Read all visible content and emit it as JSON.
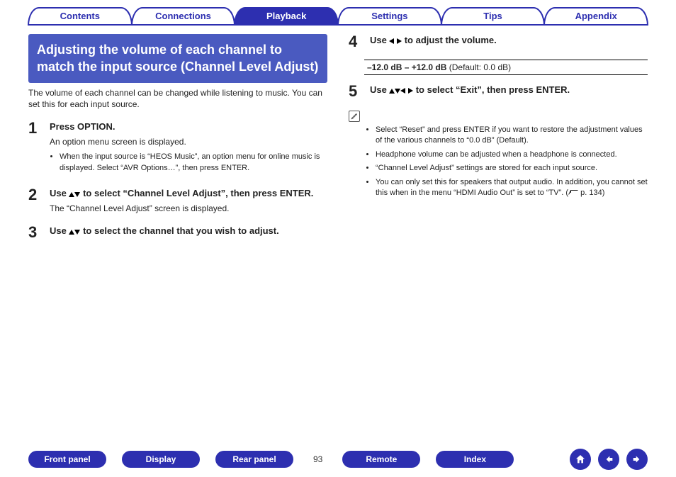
{
  "tabs": {
    "items": [
      "Contents",
      "Connections",
      "Playback",
      "Settings",
      "Tips",
      "Appendix"
    ],
    "active_index": 2
  },
  "title": "Adjusting the volume of each channel to match the input source (Channel Level Adjust)",
  "intro": "The volume of each channel can be changed while listening to music. You can set this for each input source.",
  "steps": [
    {
      "num": "1",
      "title": "Press OPTION.",
      "sub": "An option menu screen is displayed.",
      "bullets": [
        "When the input source is “HEOS Music”, an option menu for online music is displayed. Select “AVR Options…”, then press ENTER."
      ]
    },
    {
      "num": "2",
      "title_pre": "Use ",
      "title_arrows": "ud",
      "title_post": " to select “Channel Level Adjust”, then press ENTER.",
      "sub": "The “Channel Level Adjust” screen is displayed."
    },
    {
      "num": "3",
      "title_pre": "Use ",
      "title_arrows": "ud",
      "title_post": " to select the channel that you wish to adjust."
    },
    {
      "num": "4",
      "title_pre": "Use ",
      "title_arrows": "lr",
      "title_post": " to adjust the volume.",
      "range_bold": "–12.0 dB – +12.0 dB",
      "range_rest": " (Default: 0.0 dB)"
    },
    {
      "num": "5",
      "title_pre": "Use ",
      "title_arrows": "udlr",
      "title_post": " to select “Exit”, then press ENTER."
    }
  ],
  "notes": [
    "Select “Reset” and press ENTER if you want to restore the adjustment values of the various channels to “0.0 dB” (Default).",
    "Headphone volume can be adjusted when a headphone is connected.",
    "“Channel Level Adjust” settings are stored for each input source.",
    "You can only set this for speakers that output audio. In addition, you cannot set this when in the menu “HDMI Audio Out” is set to “TV”.  "
  ],
  "note_pageref": "p. 134",
  "bottom": {
    "buttons": [
      "Front panel",
      "Display",
      "Rear panel",
      "Remote",
      "Index"
    ],
    "page": "93"
  }
}
